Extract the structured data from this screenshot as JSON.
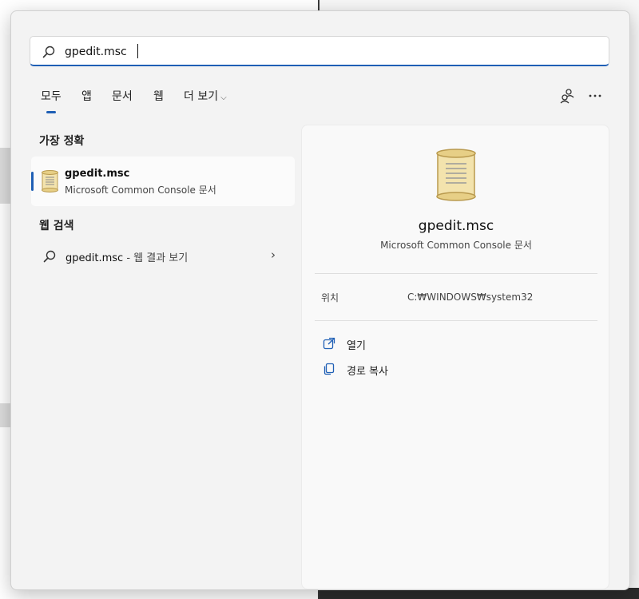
{
  "search": {
    "value": "gpedit.msc",
    "placeholder": ""
  },
  "tabs": [
    {
      "label": "모두",
      "selected": true
    },
    {
      "label": "앱"
    },
    {
      "label": "문서"
    },
    {
      "label": "웹"
    },
    {
      "label": "더 보기"
    }
  ],
  "toolbar": {
    "share_icon": "people-link-icon",
    "more_icon": "more-options-icon"
  },
  "sections": {
    "best_match": "가장 정확",
    "web_search": "웹 검색"
  },
  "best_match": {
    "title": "gpedit.msc",
    "subtitle": "Microsoft Common Console 문서",
    "icon": "scroll-document-icon"
  },
  "web_result": {
    "query": "gpedit.msc",
    "suffix": " - 웹 결과 보기",
    "icon": "search-icon"
  },
  "detail": {
    "name": "gpedit.msc",
    "type": "Microsoft Common Console 문서",
    "location_label": "위치",
    "location_value": "C:₩WINDOWS₩system32",
    "actions": [
      {
        "label": "열기",
        "icon": "open-external-icon"
      },
      {
        "label": "경로 복사",
        "icon": "copy-icon"
      }
    ]
  },
  "colors": {
    "accent": "#1f5fb5",
    "panel_bg": "#f3f3f3"
  }
}
